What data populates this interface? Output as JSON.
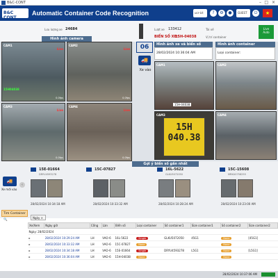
{
  "window": {
    "title": "B&C-CONT"
  },
  "header": {
    "logo": "B&C CONT",
    "title": "Automatic Container Code Recognition",
    "btn_user": "ucr-ict",
    "btn_guest": "GUEST",
    "flag": "★"
  },
  "topinfo": {
    "luu_luong_label": "Lưu lượng xe",
    "luu_luong_value": "24684",
    "luot_xe_label": "Lượt xe",
    "luot_xe_value": "133412",
    "tai_xe_label": "Tài xế",
    "bien_so_label": "BIỂN SỐ XE:",
    "bien_so_value": "15H-04038",
    "vi_tri_label": "Vị trí container",
    "lane_status": "Live",
    "lane_status2": "Auto"
  },
  "left_section": {
    "title": "Hình ảnh camera"
  },
  "cameras_left": [
    {
      "name": "CAM1",
      "tag": "Live",
      "fps": "0.0fps",
      "plate_tag": "15H04038"
    },
    {
      "name": "CAM2",
      "tag": "Live",
      "fps": "0.0fps",
      "plate_tag": ""
    },
    {
      "name": "CAM3",
      "tag": "Live",
      "fps": "0.0fps",
      "plate_tag": ""
    },
    {
      "name": "CAM4",
      "tag": "Live",
      "fps": "0.0fps",
      "plate_tag": ""
    }
  ],
  "lane": {
    "number": "06",
    "label": "Xe vào"
  },
  "right_panel": {
    "plate_header": "Hình ảnh xe và biển số",
    "container_header": "Hình ảnh container",
    "datetime": "28/02/2024 10:36:04 AM",
    "loai_container": "Loại container:",
    "cam_labels": [
      "CAM1",
      "CAM2",
      "CAM3",
      "CAM4"
    ],
    "plate_small": "15H-04038",
    "plate_line1": "15H",
    "plate_line2": "040.38"
  },
  "suggest": {
    "title": "Gợi ý biển số gần nhất",
    "label_xe_moi": "Xe mới vào",
    "items": [
      {
        "code": "15E-01664",
        "sub": "DRYU4593278",
        "time": "28/02/2024 10:34:18 AM"
      },
      {
        "code": "15C-07827",
        "sub": "",
        "time": "28/02/2024 10:33:32 AM"
      },
      {
        "code": "16L-5622",
        "sub": "GLKU5072050",
        "time": "28/02/2024 10:28:24 AM"
      },
      {
        "code": "15C-15608",
        "sub": "MRKU0758255",
        "time": "28/02/2024 10:23:00 AM"
      }
    ]
  },
  "search": {
    "button": "Tìm Container",
    "filter_chip": "Ngày"
  },
  "table": {
    "headers": [
      "Xe/Xem",
      "Ngày giờ",
      "Cổng",
      "Làn",
      "Biển số",
      "Loại container",
      "Số container1",
      "Size container1",
      "Số container2",
      "Size container2"
    ],
    "group_label": "Ngày: 28/02/2024",
    "rows": [
      {
        "datetime": "28/02/2024 10:29:24 AM",
        "gate": "LH",
        "lane": "VAO-6",
        "plate": "16L-5622",
        "type": "Single",
        "type_badge": "red",
        "c1": "GLKU5072050",
        "s1": "45G1",
        "c2": "None",
        "s2": "[45G1]"
      },
      {
        "datetime": "28/02/2024 10:33:32 AM",
        "gate": "LH",
        "lane": "VAO-6",
        "plate": "15C-07827",
        "type": "None",
        "type_badge": "orange",
        "c1": "",
        "s1": "",
        "c2": "None",
        "s2": ""
      },
      {
        "datetime": "28/02/2024 10:34:18 AM",
        "gate": "LH",
        "lane": "VAO-6",
        "plate": "15E-01664",
        "type": "Single",
        "type_badge": "red",
        "c1": "DRYU4593278",
        "s1": "L5G1",
        "c2": "None",
        "s2": "[L5G1]"
      },
      {
        "datetime": "28/02/2024 10:36:04 AM",
        "gate": "LH",
        "lane": "VAO-6",
        "plate": "15H-04038",
        "type": "None",
        "type_badge": "orange",
        "c1": "",
        "s1": "",
        "c2": "None",
        "s2": ""
      }
    ]
  },
  "status": {
    "datetime": "28/02/2024 10:37:06 AM"
  },
  "colors": {
    "header": "#0f3f8c",
    "section": "#4d6c8e",
    "badge_red": "#c82020",
    "badge_orange": "#e69f30"
  }
}
